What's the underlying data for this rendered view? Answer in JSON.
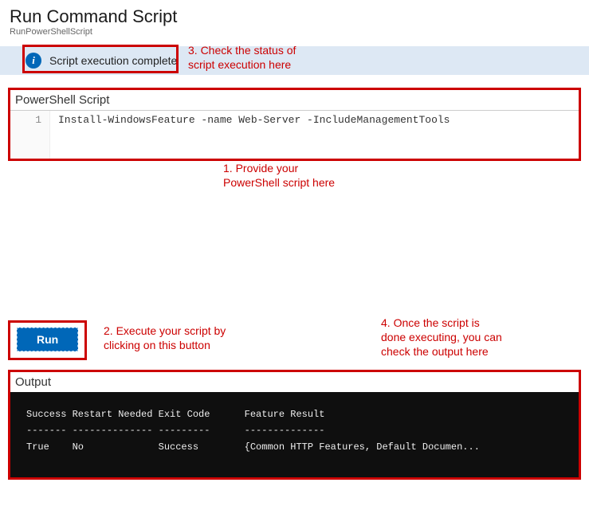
{
  "header": {
    "title": "Run Command Script",
    "subtitle": "RunPowerShellScript"
  },
  "status": {
    "icon_glyph": "i",
    "message": "Script execution complete"
  },
  "annotations": {
    "a1": "1. Provide your\nPowerShell script here",
    "a2": "2. Execute your script by\nclicking on this button",
    "a3": "3. Check the status of\nscript execution here",
    "a4": "4. Once the script is\ndone executing, you can\ncheck the output here"
  },
  "editor": {
    "label": "PowerShell Script",
    "line_number": "1",
    "code": "Install-WindowsFeature -name Web-Server -IncludeManagementTools"
  },
  "run": {
    "label": "Run"
  },
  "output": {
    "label": "Output",
    "text": "Success Restart Needed Exit Code      Feature Result\n------- -------------- ---------      --------------\nTrue    No             Success        {Common HTTP Features, Default Documen..."
  }
}
